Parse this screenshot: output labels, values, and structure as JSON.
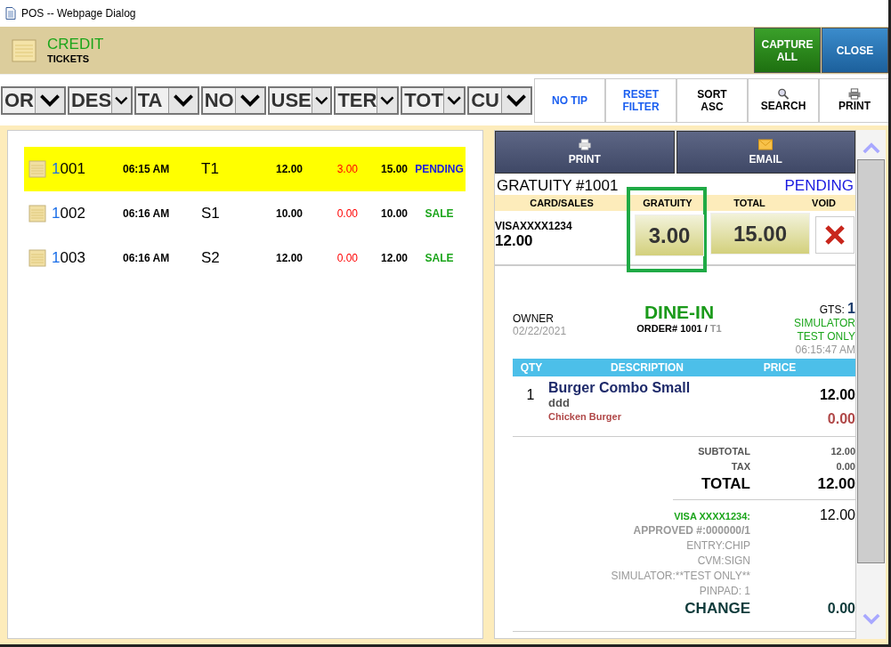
{
  "window": {
    "title": "POS -- Webpage Dialog"
  },
  "header": {
    "title": "CREDIT",
    "subtitle": "TICKETS",
    "buttons": [
      {
        "label": "CAPTURE ALL",
        "kind": "capture"
      },
      {
        "label": "CLOSE",
        "kind": "close"
      }
    ]
  },
  "filters": [
    "OR",
    "DES",
    "TA",
    "NO",
    "USE",
    "TER",
    "TOT",
    "CU"
  ],
  "toolbar": [
    {
      "label": "NO TIP",
      "kind": "blue"
    },
    {
      "label": "RESET FILTER",
      "kind": "blue"
    },
    {
      "label": "SORT ASC",
      "kind": "plain"
    },
    {
      "label": "SEARCH",
      "kind": "search"
    },
    {
      "label": "PRINT",
      "kind": "print"
    }
  ],
  "tickets": [
    {
      "number": "1001",
      "time": "06:15 AM",
      "table": "T1",
      "amount": "12.00",
      "tip": "3.00",
      "total": "15.00",
      "status": "PENDING",
      "kind": "pending",
      "selected": true
    },
    {
      "number": "1002",
      "time": "06:16 AM",
      "table": "S1",
      "amount": "10.00",
      "tip": "0.00",
      "total": "10.00",
      "status": "SALE",
      "kind": "sale",
      "selected": false
    },
    {
      "number": "1003",
      "time": "06:16 AM",
      "table": "S2",
      "amount": "12.00",
      "tip": "0.00",
      "total": "12.00",
      "status": "SALE",
      "kind": "sale",
      "selected": false
    }
  ],
  "detail": {
    "print": "PRINT",
    "email": "EMAIL",
    "title": "GRATUITY #1001",
    "status": "PENDING",
    "columns": [
      "CARD/SALES",
      "GRATUITY",
      "TOTAL",
      "VOID"
    ],
    "card": "VISAXXXX1234",
    "card_amount": "12.00",
    "gratuity": "3.00",
    "gratuity_focused": true,
    "total": "15.00"
  },
  "receipt": {
    "owner": "OWNER",
    "date": "02/22/2021",
    "order_type": "DINE-IN",
    "order_label": "ORDER#",
    "order_number": "1001",
    "order_sep": "/",
    "order_table": "T1",
    "gts_label": "GTS:",
    "gts_value": "1",
    "sim": "SIMULATOR",
    "test": "TEST ONLY",
    "time": "06:15:47 AM",
    "columns": [
      "QTY",
      "DESCRIPTION",
      "PRICE"
    ],
    "items": [
      {
        "qty": "1",
        "name": "Burger Combo Small",
        "note": "ddd",
        "price": "12.00",
        "modifier": "Chicken Burger",
        "modifier_price": "0.00"
      }
    ],
    "subtotal_label": "SUBTOTAL",
    "subtotal": "12.00",
    "tax_label": "TAX",
    "tax": "0.00",
    "total_label": "TOTAL",
    "total": "12.00",
    "payment_label": "VISA XXXX1234:",
    "payment": "12.00",
    "payment_lines": [
      "APPROVED #:000000/1",
      "ENTRY:CHIP",
      "CVM:SIGN",
      "SIMULATOR:**TEST ONLY**",
      "PINPAD: 1"
    ],
    "change_label": "CHANGE",
    "change": "0.00"
  }
}
